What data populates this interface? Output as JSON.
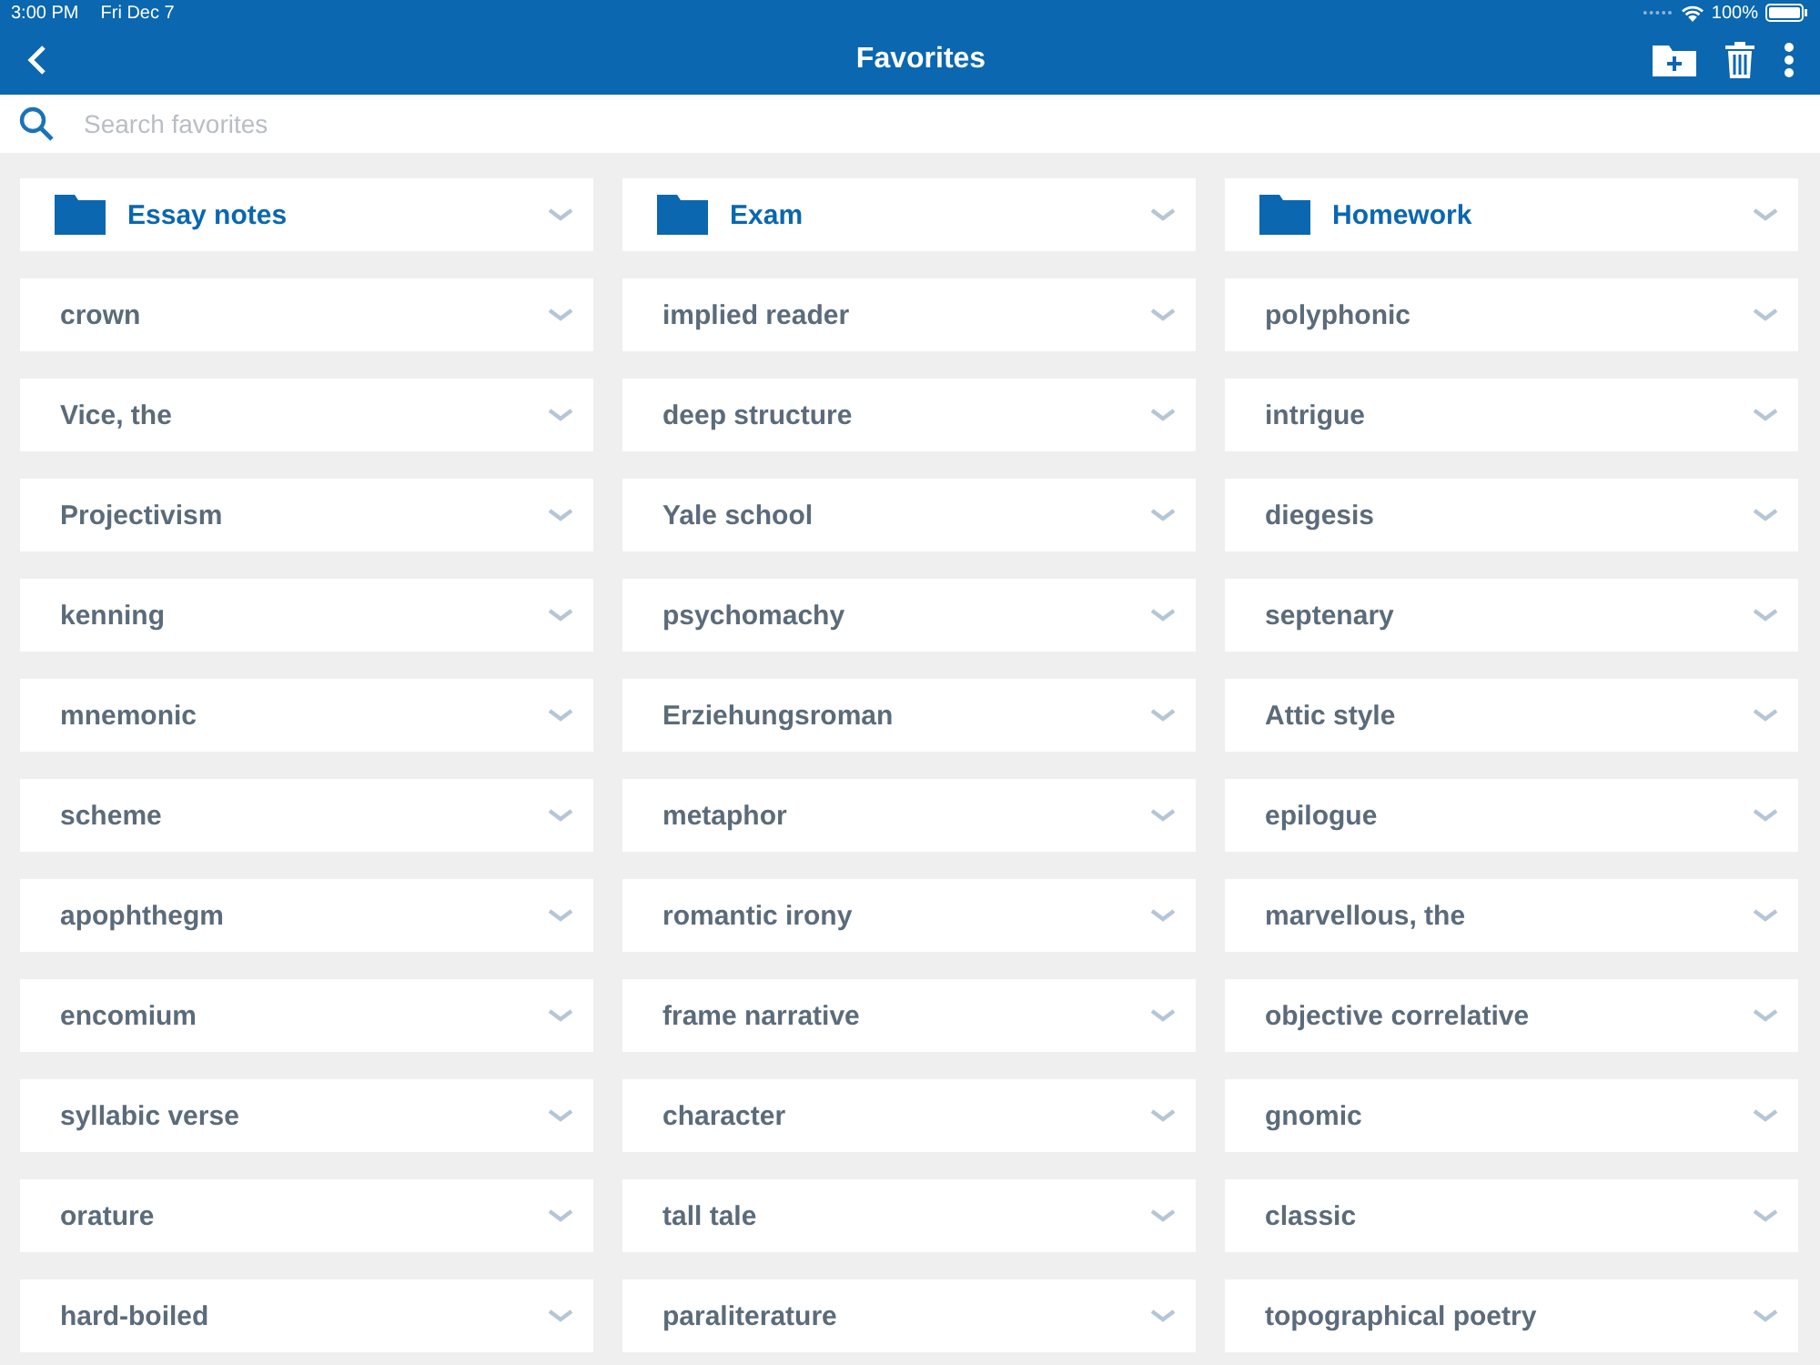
{
  "status_bar": {
    "time": "3:00 PM",
    "date": "Fri Dec 7",
    "battery": "100%"
  },
  "header": {
    "title": "Favorites"
  },
  "search": {
    "placeholder": "Search favorites"
  },
  "columns": [
    {
      "folder": "Essay notes",
      "items": [
        "crown",
        "Vice, the",
        "Projectivism",
        "kenning",
        "mnemonic",
        "scheme",
        "apophthegm",
        "encomium",
        "syllabic verse",
        "orature",
        "hard-boiled"
      ]
    },
    {
      "folder": "Exam",
      "items": [
        "implied reader",
        "deep structure",
        "Yale school",
        "psychomachy",
        "Erziehungsroman",
        "metaphor",
        "romantic irony",
        "frame narrative",
        "character",
        "tall tale",
        "paraliterature"
      ]
    },
    {
      "folder": "Homework",
      "items": [
        "polyphonic",
        "intrigue",
        "diegesis",
        "septenary",
        "Attic style",
        "epilogue",
        "marvellous, the",
        "objective correlative",
        "gnomic",
        "classic",
        "topographical poetry"
      ]
    }
  ]
}
